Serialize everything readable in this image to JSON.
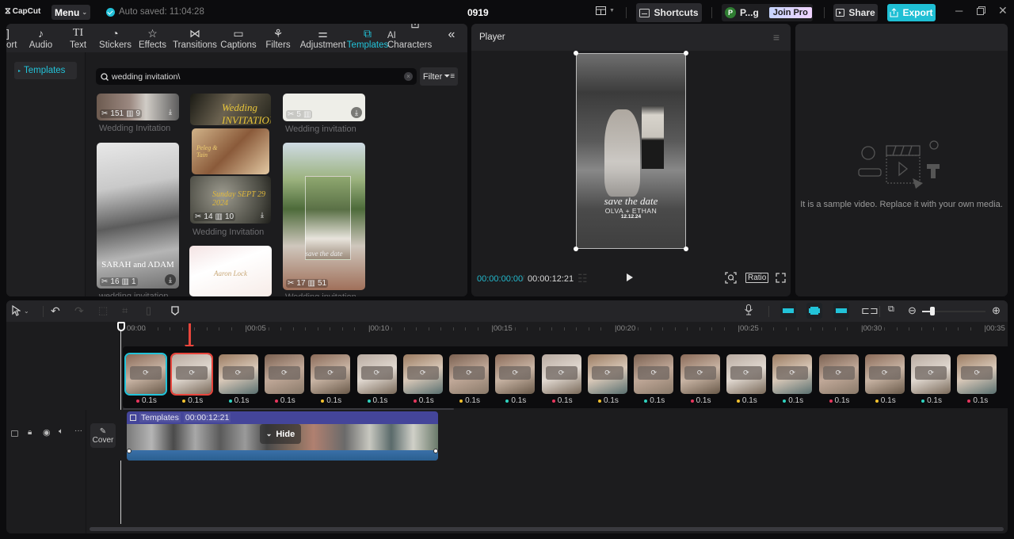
{
  "titlebar": {
    "app_name": "CapCut",
    "menu_label": "Menu",
    "autosave_text": "Auto saved: 11:04:28",
    "project_title": "0919",
    "shortcuts_label": "Shortcuts",
    "user_initial": "P",
    "user_name": "P...g",
    "join_pro_label": "Join Pro",
    "share_label": "Share",
    "export_label": "Export",
    "accent_color": "#22c3d9"
  },
  "toolbar": {
    "tabs": [
      {
        "label": "ort",
        "icon": "import-icon"
      },
      {
        "label": "Audio",
        "icon": "audio-icon"
      },
      {
        "label": "Text",
        "icon": "text-icon"
      },
      {
        "label": "Stickers",
        "icon": "sticker-icon"
      },
      {
        "label": "Effects",
        "icon": "effects-icon"
      },
      {
        "label": "Transitions",
        "icon": "transitions-icon"
      },
      {
        "label": "Captions",
        "icon": "captions-icon"
      },
      {
        "label": "Filters",
        "icon": "filters-icon"
      },
      {
        "label": "Adjustment",
        "icon": "adjustment-icon"
      },
      {
        "label": "Templates",
        "icon": "templates-icon",
        "active": true
      },
      {
        "label": "AI Characters",
        "icon": "ai-characters-icon"
      }
    ],
    "collapse_icon": "double-chevron-left-icon"
  },
  "media": {
    "sidebar": {
      "items": [
        {
          "label": "Templates",
          "active": true
        }
      ]
    },
    "search": {
      "value": "wedding invitation\\",
      "placeholder": "Search"
    },
    "filter_label": "Filter",
    "cards": [
      {
        "title": "Wedding Invitation",
        "clips": "151",
        "scenes": "9"
      },
      {
        "title": "",
        "overlay_text": "Wedding INVITATION"
      },
      {
        "title": "Wedding invitation",
        "clips": "5",
        "scenes": ""
      },
      {
        "title": "",
        "overlay_text": "Peleg & Tain"
      },
      {
        "title": "wedding invitation",
        "clips": "16",
        "scenes": "1",
        "overlay_text": "SARAH and ADAM"
      },
      {
        "title": "Wedding Invitation",
        "clips": "14",
        "scenes": "10",
        "overlay_text": "Sunday SEPT 29 2024"
      },
      {
        "title": "",
        "overlay_text": "Aaron Lock"
      },
      {
        "title": "Wedding invitation",
        "clips": "17",
        "scenes": "51",
        "overlay_text": "save the date"
      }
    ]
  },
  "player": {
    "title": "Player",
    "video_text": {
      "line1": "save the date",
      "line2": "OLVA + ETHAN",
      "line3": "12.12.24"
    },
    "current_time": "00:00:00:00",
    "total_time": "00:00:12:21",
    "ratio_label": "Ratio"
  },
  "details": {
    "sample_text": "It is a sample video. Replace it with your own media."
  },
  "timeline": {
    "ruler_labels": [
      "00:00",
      "|00:05",
      "|00:10",
      "|00:15",
      "|00:20",
      "|00:25",
      "|00:30",
      "|00:35"
    ],
    "thumbnails": [
      {
        "duration": "0.1s",
        "dot": "#e8365d",
        "selected": true
      },
      {
        "duration": "0.1s",
        "dot": "#f2c12e",
        "highlighted": true
      },
      {
        "duration": "0.1s",
        "dot": "#2ed3c0"
      },
      {
        "duration": "0.1s",
        "dot": "#e8365d"
      },
      {
        "duration": "0.1s",
        "dot": "#f2c12e"
      },
      {
        "duration": "0.1s",
        "dot": "#2ed3c0"
      },
      {
        "duration": "0.1s",
        "dot": "#e8365d"
      },
      {
        "duration": "0.1s",
        "dot": "#f2c12e"
      },
      {
        "duration": "0.1s",
        "dot": "#2ed3c0"
      },
      {
        "duration": "0.1s",
        "dot": "#e8365d"
      },
      {
        "duration": "0.1s",
        "dot": "#f2c12e"
      },
      {
        "duration": "0.1s",
        "dot": "#2ed3c0"
      },
      {
        "duration": "0.1s",
        "dot": "#e8365d"
      },
      {
        "duration": "0.1s",
        "dot": "#f2c12e"
      },
      {
        "duration": "0.1s",
        "dot": "#2ed3c0"
      },
      {
        "duration": "0.1s",
        "dot": "#e8365d"
      },
      {
        "duration": "0.1s",
        "dot": "#f2c12e"
      },
      {
        "duration": "0.1s",
        "dot": "#2ed3c0"
      },
      {
        "duration": "0.1s",
        "dot": "#e8365d"
      }
    ],
    "clip": {
      "label": "Templates",
      "duration": "00:00:12:21",
      "hide_label": "Hide"
    },
    "cover_label": "Cover",
    "zoom_level": 0.1
  }
}
